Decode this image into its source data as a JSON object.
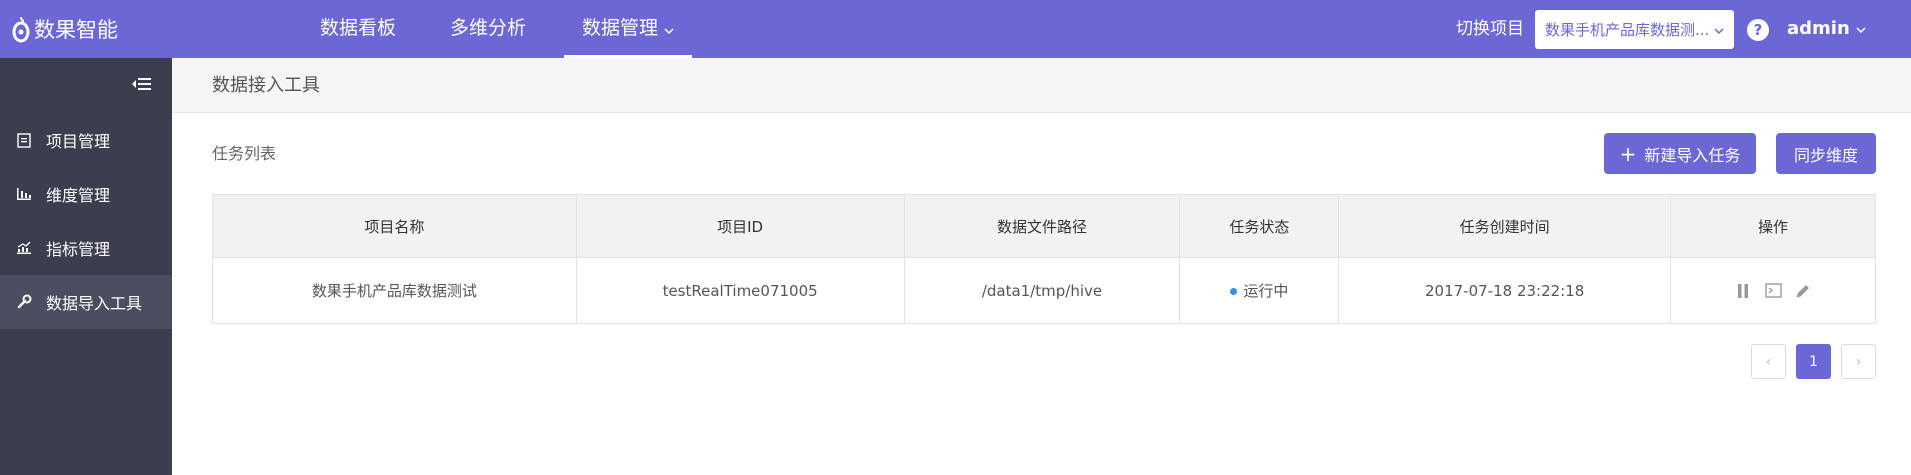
{
  "header": {
    "logo_text": "数果智能",
    "nav": [
      {
        "label": "数据看板"
      },
      {
        "label": "多维分析"
      },
      {
        "label": "数据管理"
      }
    ],
    "switch_label": "切换项目",
    "project_select_value": "数果手机产品库数据测...",
    "help_label": "?",
    "user_name": "admin"
  },
  "sidebar": {
    "items": [
      {
        "label": "项目管理",
        "icon": "document-icon"
      },
      {
        "label": "维度管理",
        "icon": "bar-chart-icon"
      },
      {
        "label": "指标管理",
        "icon": "trend-chart-icon"
      },
      {
        "label": "数据导入工具",
        "icon": "wrench-icon"
      }
    ]
  },
  "main": {
    "page_title": "数据接入工具",
    "section_title": "任务列表",
    "new_task_button": "新建导入任务",
    "sync_button": "同步维度",
    "table": {
      "columns": [
        "项目名称",
        "项目ID",
        "数据文件路径",
        "任务状态",
        "任务创建时间",
        "操作"
      ],
      "rows": [
        {
          "project_name": "数果手机产品库数据测试",
          "project_id": "testRealTime071005",
          "path": "/data1/tmp/hive",
          "status": "运行中",
          "created": "2017-07-18 23:22:18"
        }
      ]
    },
    "pagination": {
      "prev": "‹",
      "current": "1",
      "next": "›"
    }
  },
  "colors": {
    "brand": "#6b68d6",
    "sidebar": "#3b3e4e",
    "status_running": "#3b8fe0"
  }
}
